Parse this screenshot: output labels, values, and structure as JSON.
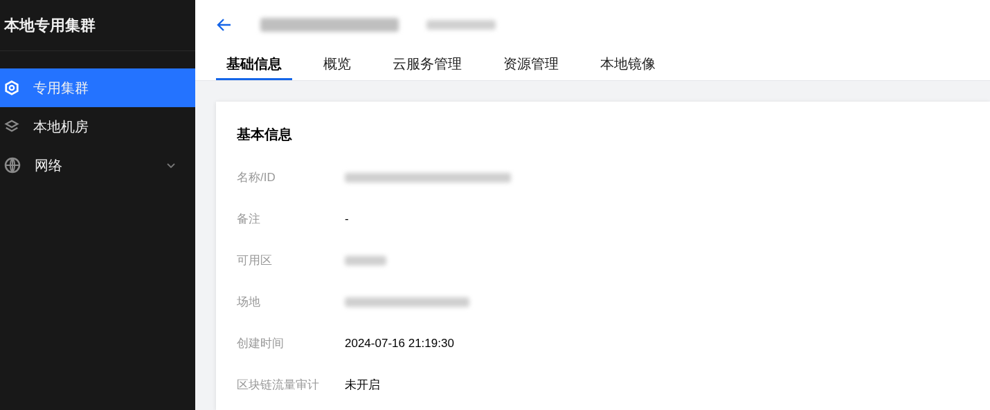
{
  "sidebar": {
    "title": "本地专用集群",
    "items": [
      {
        "label": "专用集群",
        "selected": true,
        "kind": "link"
      },
      {
        "label": "本地机房",
        "selected": false,
        "kind": "link"
      },
      {
        "label": "网络",
        "selected": false,
        "kind": "group",
        "expanded": false
      }
    ]
  },
  "header": {
    "title_redacted": true,
    "tabs": [
      {
        "label": "基础信息",
        "selected": true
      },
      {
        "label": "概览",
        "selected": false
      },
      {
        "label": "云服务管理",
        "selected": false
      },
      {
        "label": "资源管理",
        "selected": false
      },
      {
        "label": "本地镜像",
        "selected": false
      }
    ]
  },
  "card": {
    "title": "基本信息",
    "rows": [
      {
        "label": "名称/ID",
        "kind": "redacted"
      },
      {
        "label": "备注",
        "kind": "text",
        "value": "-"
      },
      {
        "label": "可用区",
        "kind": "redacted"
      },
      {
        "label": "场地",
        "kind": "redacted"
      },
      {
        "label": "创建时间",
        "kind": "text",
        "value": "2024-07-16 21:19:30"
      },
      {
        "label": "区块链流量审计",
        "kind": "text",
        "value": "未开启"
      }
    ]
  }
}
